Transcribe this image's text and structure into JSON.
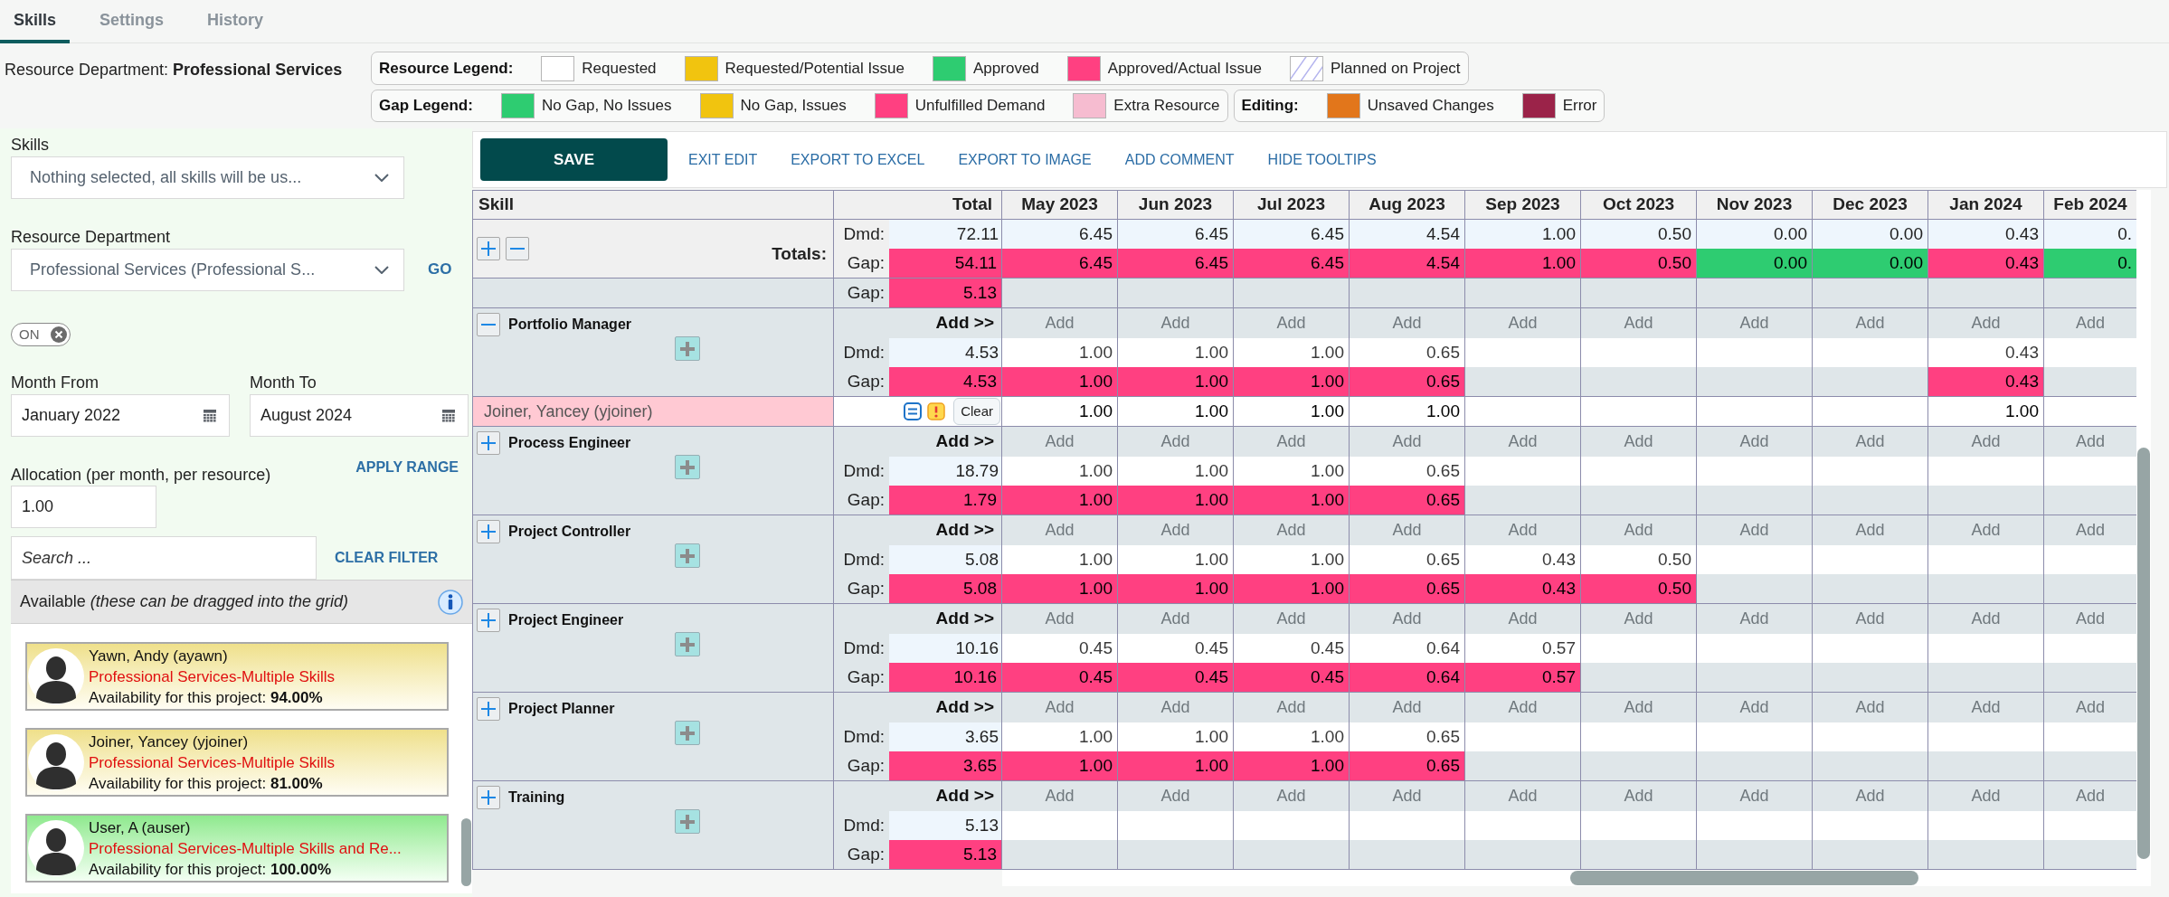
{
  "tabs": [
    {
      "label": "Skills",
      "selected": true
    },
    {
      "label": "Settings",
      "selected": false
    },
    {
      "label": "History",
      "selected": false
    }
  ],
  "department_line": "Resource Department: **Professional Services**",
  "resource_legend": {
    "title": "Resource Legend:",
    "items": [
      {
        "label": "Requested",
        "color": "#ffffff",
        "kind": "solid"
      },
      {
        "label": "Requested/Potential Issue",
        "color": "#f1c40f",
        "kind": "solid"
      },
      {
        "label": "Approved",
        "color": "#2ecc71",
        "kind": "solid"
      },
      {
        "label": "Approved/Actual Issue",
        "color": "#ff4081",
        "kind": "solid"
      },
      {
        "label": "Planned on Project",
        "color": "#b4b4ee",
        "kind": "hatched"
      }
    ]
  },
  "gap_legend": {
    "title": "Gap Legend:",
    "items": [
      {
        "label": "No Gap, No Issues",
        "color": "#2ecc71"
      },
      {
        "label": "No Gap, Issues",
        "color": "#f1c40f"
      },
      {
        "label": "Unfulfilled Demand",
        "color": "#ff4081"
      },
      {
        "label": "Extra Resource",
        "color": "#f6bcd0"
      }
    ]
  },
  "editing_legend": {
    "title": "Editing:",
    "items": [
      {
        "label": "Unsaved Changes",
        "color": "#e2761b"
      },
      {
        "label": "Error",
        "color": "#9b2349"
      }
    ]
  },
  "filters": {
    "skills": {
      "label": "Skills",
      "value": "Nothing selected, all skills will be us..."
    },
    "department": {
      "label": "Resource Department",
      "value": "Professional Services (Professional S...",
      "action": "GO"
    },
    "toggle": {
      "label": "ON",
      "on": true
    },
    "month_from": {
      "label": "Month From",
      "value": "January 2022"
    },
    "month_to": {
      "label": "Month To",
      "value": "August 2024"
    },
    "allocation": {
      "label": "Allocation (per month, per resource)",
      "value": "1.00",
      "action": "APPLY RANGE"
    },
    "search": {
      "placeholder": "Search ...",
      "action": "CLEAR FILTER"
    }
  },
  "available": {
    "title": "Available  *(these can be dragged into the grid)*",
    "resources": [
      {
        "name": "Yawn, Andy (ayawn)",
        "department": "Professional Services-Multiple Skills",
        "availability": "Availability for this project: **94.00%**",
        "fully_available": false
      },
      {
        "name": "Joiner, Yancey (yjoiner)",
        "department": "Professional Services-Multiple Skills",
        "availability": "Availability for this project: **81.00%**",
        "fully_available": false
      },
      {
        "name": "User, A (auser)",
        "department": "Professional Services-Multiple Skills and Re...",
        "availability": "Availability for this project: **100.00%**",
        "fully_available": true
      }
    ]
  },
  "grid": {
    "toolbar": {
      "save": "SAVE",
      "links": [
        "EXIT EDIT",
        "EXPORT TO EXCEL",
        "EXPORT TO IMAGE",
        "ADD COMMENT",
        "HIDE TOOLTIPS"
      ]
    },
    "columns": [
      "Skill",
      "Total",
      "May 2023",
      "Jun 2023",
      "Jul 2023",
      "Aug 2023",
      "Sep 2023",
      "Oct 2023",
      "Nov 2023",
      "Dec 2023",
      "Jan 2024",
      "Feb 2024"
    ],
    "totals": {
      "label": "Totals:",
      "dmd_label": "Dmd:",
      "gap_label": "Gap:",
      "dmd": "72.11",
      "gap": {
        "value": "54.11",
        "color": "#ff4081"
      },
      "months_dmd": [
        "6.45",
        "6.45",
        "6.45",
        "4.54",
        "1.00",
        "0.50",
        "0.00",
        "0.00",
        "0.43",
        "0."
      ],
      "months_gap": [
        {
          "value": "6.45",
          "color": "#ff4081"
        },
        {
          "value": "6.45",
          "color": "#ff4081"
        },
        {
          "value": "6.45",
          "color": "#ff4081"
        },
        {
          "value": "4.54",
          "color": "#ff4081"
        },
        {
          "value": "1.00",
          "color": "#ff4081"
        },
        {
          "value": "0.50",
          "color": "#ff4081"
        },
        {
          "value": "0.00",
          "color": "#2ecc71"
        },
        {
          "value": "0.00",
          "color": "#2ecc71"
        },
        {
          "value": "0.43",
          "color": "#ff4081"
        },
        {
          "value": "0.",
          "color": "#2ecc71"
        }
      ]
    },
    "gap_row": {
      "label": "Gap:",
      "gap": {
        "value": "5.13",
        "color": "#ff4081"
      }
    },
    "groups": [
      {
        "name": "Portfolio Manager",
        "expanded": true,
        "add_label": "Add >>",
        "dmd_label": "Dmd:",
        "gap_label": "Gap:",
        "dmd": "4.53",
        "gap": {
          "value": "4.53",
          "color": "#ff4081"
        },
        "cells": [
          {
            "add": "Add",
            "dmd": "1.00",
            "gap": {
              "value": "1.00",
              "color": "#ff4081"
            }
          },
          {
            "add": "Add",
            "dmd": "1.00",
            "gap": {
              "value": "1.00",
              "color": "#ff4081"
            }
          },
          {
            "add": "Add",
            "dmd": "1.00",
            "gap": {
              "value": "1.00",
              "color": "#ff4081"
            }
          },
          {
            "add": "Add",
            "dmd": "0.65",
            "gap": {
              "value": "0.65",
              "color": "#ff4081"
            }
          },
          {
            "add": "Add"
          },
          {
            "add": "Add"
          },
          {
            "add": "Add"
          },
          {
            "add": "Add"
          },
          {
            "add": "Add",
            "dmd": "0.43",
            "gap": {
              "value": "0.43",
              "color": "#ff4081"
            }
          },
          {
            "add": "Add"
          }
        ],
        "resources": [
          {
            "name": "Joiner, Yancey (yjoiner)",
            "clear": "Clear",
            "cells": [
              {
                "kind": "value",
                "value": "1.00"
              },
              {
                "kind": "value",
                "value": "1.00"
              },
              {
                "kind": "value",
                "value": "1.00"
              },
              {
                "kind": "value",
                "value": "1.00"
              },
              {
                "kind": "blank"
              },
              {
                "kind": "blank"
              },
              {
                "kind": "blank"
              },
              {
                "kind": "blank"
              },
              {
                "kind": "value",
                "value": "1.00"
              },
              {
                "kind": "blank"
              }
            ]
          }
        ]
      },
      {
        "name": "Process Engineer",
        "expanded": false,
        "add_label": "Add >>",
        "dmd_label": "Dmd:",
        "gap_label": "Gap:",
        "dmd": "18.79",
        "gap": {
          "value": "1.79",
          "color": "#ff4081"
        },
        "cells": [
          {
            "add": "Add",
            "dmd": "1.00",
            "gap": {
              "value": "1.00",
              "color": "#ff4081"
            }
          },
          {
            "add": "Add",
            "dmd": "1.00",
            "gap": {
              "value": "1.00",
              "color": "#ff4081"
            }
          },
          {
            "add": "Add",
            "dmd": "1.00",
            "gap": {
              "value": "1.00",
              "color": "#ff4081"
            }
          },
          {
            "add": "Add",
            "dmd": "0.65",
            "gap": {
              "value": "0.65",
              "color": "#ff4081"
            }
          },
          {
            "add": "Add"
          },
          {
            "add": "Add"
          },
          {
            "add": "Add"
          },
          {
            "add": "Add"
          },
          {
            "add": "Add"
          },
          {
            "add": "Add"
          }
        ]
      },
      {
        "name": "Project Controller",
        "expanded": false,
        "add_label": "Add >>",
        "dmd_label": "Dmd:",
        "gap_label": "Gap:",
        "dmd": "5.08",
        "gap": {
          "value": "5.08",
          "color": "#ff4081"
        },
        "cells": [
          {
            "add": "Add",
            "dmd": "1.00",
            "gap": {
              "value": "1.00",
              "color": "#ff4081"
            }
          },
          {
            "add": "Add",
            "dmd": "1.00",
            "gap": {
              "value": "1.00",
              "color": "#ff4081"
            }
          },
          {
            "add": "Add",
            "dmd": "1.00",
            "gap": {
              "value": "1.00",
              "color": "#ff4081"
            }
          },
          {
            "add": "Add",
            "dmd": "0.65",
            "gap": {
              "value": "0.65",
              "color": "#ff4081"
            }
          },
          {
            "add": "Add",
            "dmd": "0.43",
            "gap": {
              "value": "0.43",
              "color": "#ff4081"
            }
          },
          {
            "add": "Add",
            "dmd": "0.50",
            "gap": {
              "value": "0.50",
              "color": "#ff4081"
            }
          },
          {
            "add": "Add"
          },
          {
            "add": "Add"
          },
          {
            "add": "Add"
          },
          {
            "add": "Add"
          }
        ]
      },
      {
        "name": "Project Engineer",
        "expanded": false,
        "add_label": "Add >>",
        "dmd_label": "Dmd:",
        "gap_label": "Gap:",
        "dmd": "10.16",
        "gap": {
          "value": "10.16",
          "color": "#ff4081"
        },
        "cells": [
          {
            "add": "Add",
            "dmd": "0.45",
            "gap": {
              "value": "0.45",
              "color": "#ff4081"
            }
          },
          {
            "add": "Add",
            "dmd": "0.45",
            "gap": {
              "value": "0.45",
              "color": "#ff4081"
            }
          },
          {
            "add": "Add",
            "dmd": "0.45",
            "gap": {
              "value": "0.45",
              "color": "#ff4081"
            }
          },
          {
            "add": "Add",
            "dmd": "0.64",
            "gap": {
              "value": "0.64",
              "color": "#ff4081"
            }
          },
          {
            "add": "Add",
            "dmd": "0.57",
            "gap": {
              "value": "0.57",
              "color": "#ff4081"
            }
          },
          {
            "add": "Add"
          },
          {
            "add": "Add"
          },
          {
            "add": "Add"
          },
          {
            "add": "Add"
          },
          {
            "add": "Add"
          }
        ]
      },
      {
        "name": "Project Planner",
        "expanded": false,
        "add_label": "Add >>",
        "dmd_label": "Dmd:",
        "gap_label": "Gap:",
        "dmd": "3.65",
        "gap": {
          "value": "3.65",
          "color": "#ff4081"
        },
        "cells": [
          {
            "add": "Add",
            "dmd": "1.00",
            "gap": {
              "value": "1.00",
              "color": "#ff4081"
            }
          },
          {
            "add": "Add",
            "dmd": "1.00",
            "gap": {
              "value": "1.00",
              "color": "#ff4081"
            }
          },
          {
            "add": "Add",
            "dmd": "1.00",
            "gap": {
              "value": "1.00",
              "color": "#ff4081"
            }
          },
          {
            "add": "Add",
            "dmd": "0.65",
            "gap": {
              "value": "0.65",
              "color": "#ff4081"
            }
          },
          {
            "add": "Add"
          },
          {
            "add": "Add"
          },
          {
            "add": "Add"
          },
          {
            "add": "Add"
          },
          {
            "add": "Add"
          },
          {
            "add": "Add"
          }
        ]
      },
      {
        "name": "Training",
        "expanded": false,
        "add_label": "Add >>",
        "dmd_label": "Dmd:",
        "gap_label": "Gap:",
        "dmd": "5.13",
        "gap": {
          "value": "5.13",
          "color": "#ff4081"
        },
        "cells": [
          {
            "add": "Add"
          },
          {
            "add": "Add"
          },
          {
            "add": "Add"
          },
          {
            "add": "Add"
          },
          {
            "add": "Add"
          },
          {
            "add": "Add"
          },
          {
            "add": "Add"
          },
          {
            "add": "Add"
          },
          {
            "add": "Add"
          },
          {
            "add": "Add"
          }
        ]
      }
    ]
  }
}
